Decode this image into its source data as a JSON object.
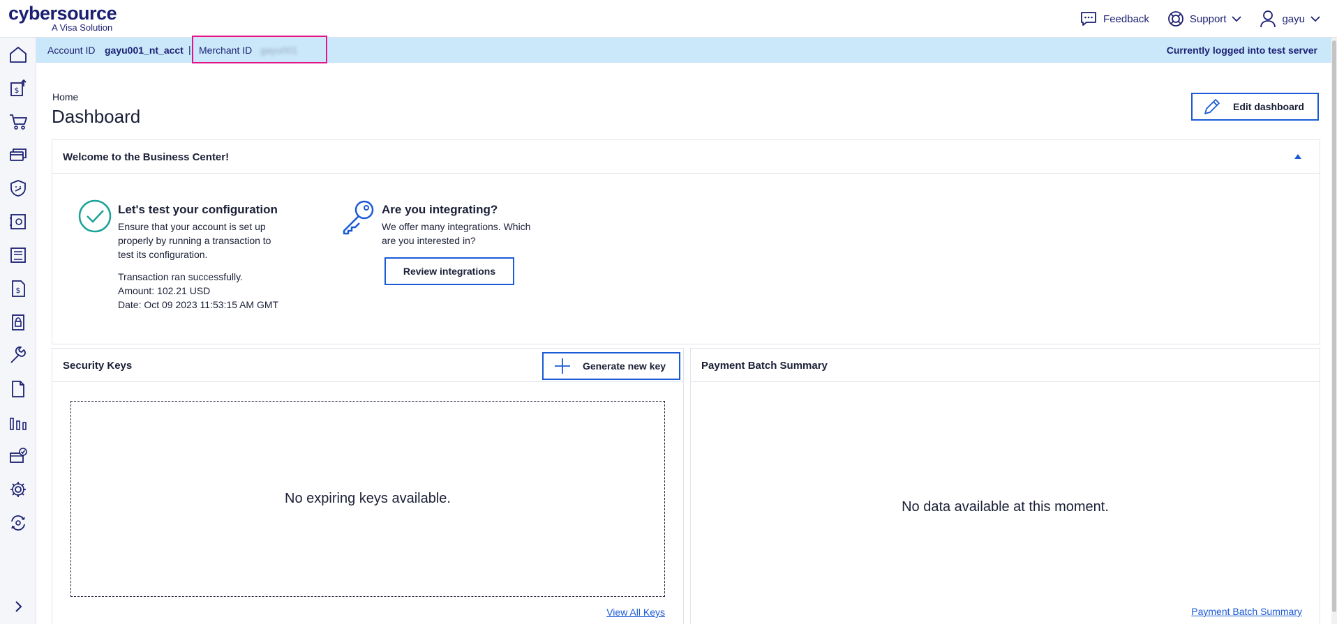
{
  "brand": {
    "name": "cybersource",
    "tagline": "A Visa Solution"
  },
  "header": {
    "feedback_label": "Feedback",
    "support_label": "Support",
    "user_label": "gayu"
  },
  "sidebar": {
    "items": [
      "home-icon",
      "payments-icon",
      "cart-icon",
      "cards-icon",
      "fraud-shield-icon",
      "safe-icon",
      "terminal-icon",
      "invoice-icon",
      "vault-icon",
      "tools-icon",
      "document-icon",
      "reports-icon",
      "card-check-icon",
      "settings-icon",
      "exchange-icon"
    ]
  },
  "account": {
    "account_label": "Account ID",
    "account_value": "gayu001_nt_acct",
    "separator": "|",
    "merchant_label": "Merchant ID",
    "merchant_value": "gayu001",
    "server_status": "Currently logged into test server"
  },
  "page": {
    "breadcrumb": "Home",
    "title": "Dashboard",
    "edit_label": "Edit dashboard"
  },
  "welcome": {
    "title": "Welcome to the Business Center!",
    "config_title": "Let's test your configuration",
    "config_desc": "Ensure that your account is set up properly by running a transaction to test its configuration.",
    "txn_status": "Transaction ran successfully.",
    "txn_amount": "Amount: 102.21 USD",
    "txn_date": "Date: Oct 09 2023 11:53:15 AM GMT",
    "integ_title": "Are you integrating?",
    "integ_desc": "We offer many integrations. Which are you interested in?",
    "review_label": "Review integrations"
  },
  "security_keys": {
    "title": "Security Keys",
    "generate_label": "Generate new key",
    "empty_text": "No expiring keys available.",
    "view_all_label": "View All Keys"
  },
  "payment_batch": {
    "title": "Payment Batch Summary",
    "empty_text": "No data available at this moment.",
    "link_label": "Payment Batch Summary"
  },
  "colors": {
    "brand_navy": "#1a1f71",
    "accent_blue": "#1a5ad6",
    "strip_bg": "#cbe8fb",
    "success_teal": "#1aa398",
    "highlight_magenta": "#e2148c"
  }
}
